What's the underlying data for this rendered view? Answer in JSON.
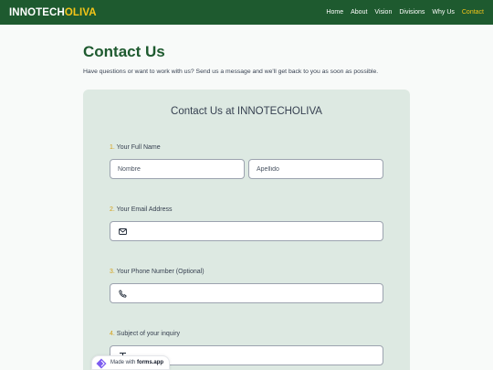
{
  "nav": {
    "brand_main": "INNOTECH",
    "brand_accent": "OLIVA",
    "links": [
      {
        "label": "Home"
      },
      {
        "label": "About"
      },
      {
        "label": "Vision"
      },
      {
        "label": "Divisions"
      },
      {
        "label": "Why Us"
      },
      {
        "label": "Contact"
      }
    ],
    "active": "Contact"
  },
  "main": {
    "title": "Contact Us",
    "intro": "Have questions or want to work with us? Send us a message and we'll get back to you as soon as possible."
  },
  "form": {
    "title": "Contact Us at INNOTECHOLIVA",
    "questions": [
      {
        "num": "1.",
        "label": "Your Full Name"
      },
      {
        "num": "2.",
        "label": "Your Email Address"
      },
      {
        "num": "3.",
        "label": "Your Phone Number (Optional)"
      },
      {
        "num": "4.",
        "label": "Subject of your inquiry"
      }
    ],
    "first_name_placeholder": "Nombre",
    "last_name_placeholder": "Apellido",
    "email_value": "",
    "phone_value": "",
    "subject_value": ""
  },
  "badge": {
    "prefix": "Made with",
    "brand": "forms.app"
  },
  "colors": {
    "navbar": "#1e5a2f",
    "accent": "#f5c518",
    "card": "#dde9e2",
    "question_number": "#d4a017"
  },
  "icons": {
    "email": "envelope-icon",
    "phone": "phone-icon",
    "subject": "text-icon",
    "badge": "forms-app-logo-icon"
  }
}
